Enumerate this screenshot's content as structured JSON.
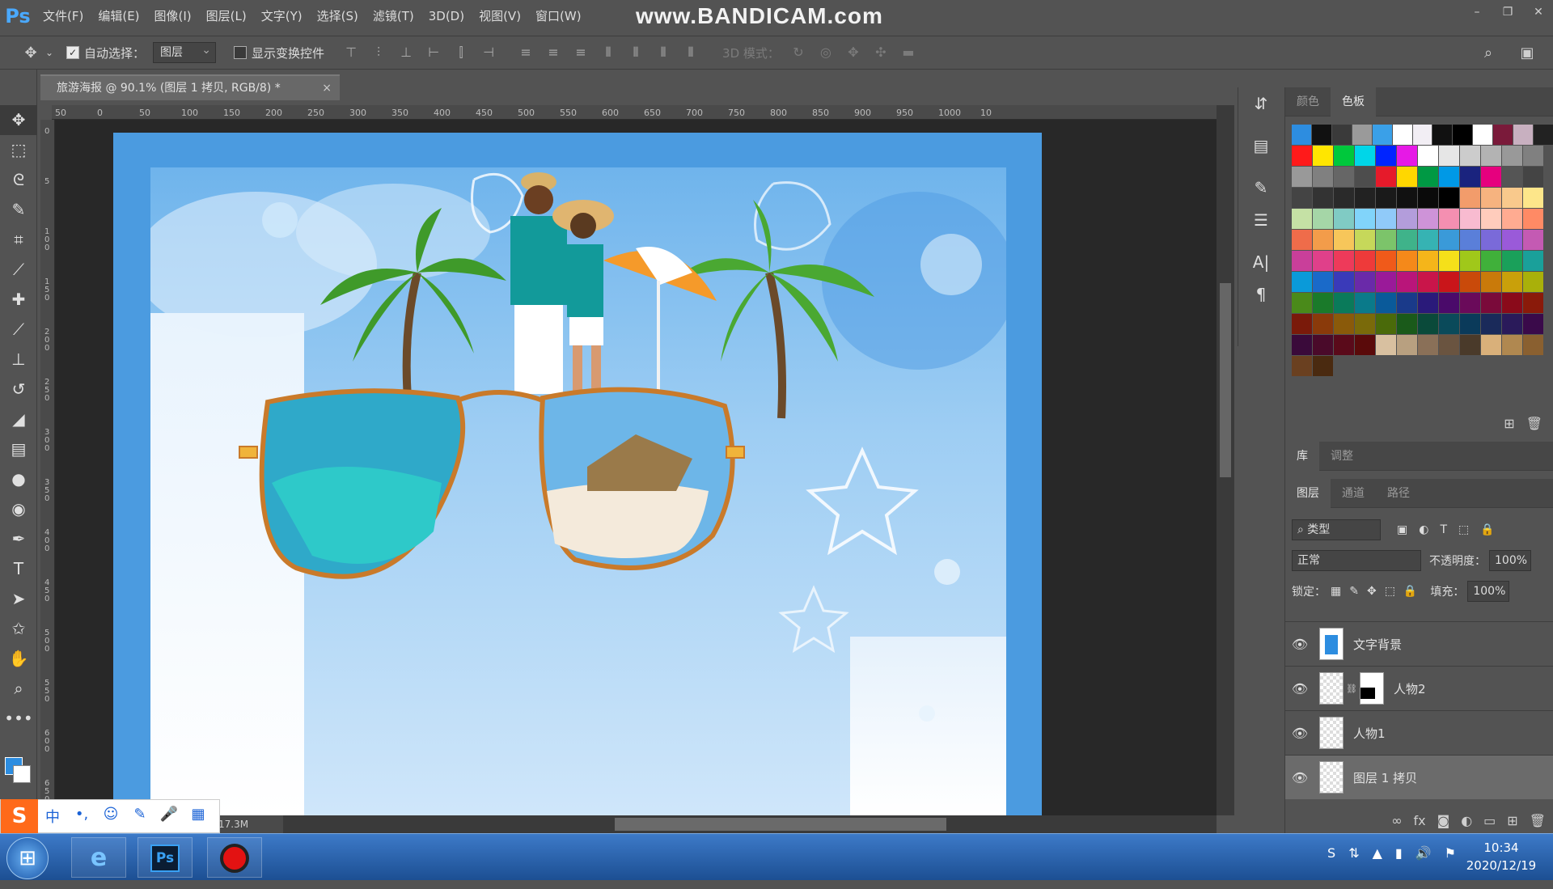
{
  "app": {
    "logo": "Ps",
    "menu": [
      "文件(F)",
      "编辑(E)",
      "图像(I)",
      "图层(L)",
      "文字(Y)",
      "选择(S)",
      "滤镜(T)",
      "3D(D)",
      "视图(V)",
      "窗口(W)"
    ],
    "watermark": "www.BANDICAM.com"
  },
  "options": {
    "auto_select_label": "自动选择：",
    "auto_select_target": "图层",
    "show_transform_label": "显示变换控件",
    "mode_3d_label": "3D 模式："
  },
  "document": {
    "tab_title": "旅游海报 @ 90.1% (图层 1 拷贝, RGB/8) *",
    "close": "×",
    "status_text": "17.3M",
    "ruler_h": [
      "50",
      "0",
      "50",
      "100",
      "150",
      "200",
      "250",
      "300",
      "350",
      "400",
      "450",
      "500",
      "550",
      "600",
      "650",
      "700",
      "750",
      "800",
      "850",
      "900",
      "950",
      "1000",
      "10"
    ],
    "ruler_v": [
      "0",
      "5",
      "1 0 0",
      "1 5 0",
      "2 0 0",
      "2 5 0",
      "3 0 0",
      "3 5 0",
      "4 0 0",
      "4 5 0",
      "5 0 0",
      "5 5 0",
      "6 0 0",
      "6 5 0"
    ]
  },
  "panels": {
    "swatch_tabs": [
      "颜色",
      "色板"
    ],
    "library_tabs": [
      "库",
      "调整"
    ],
    "layer_tabs": [
      "图层",
      "通道",
      "路径"
    ],
    "filter_kind": "类型",
    "blend_mode": "正常",
    "opacity_label": "不透明度：",
    "opacity_value": "100%",
    "lock_label": "锁定：",
    "fill_label": "填充：",
    "fill_value": "100%",
    "layers": [
      {
        "name": "文字背景",
        "thumb": "blue",
        "selected": false
      },
      {
        "name": "人物2",
        "thumb": "mask",
        "selected": false
      },
      {
        "name": "人物1",
        "thumb": "transparent",
        "selected": false
      },
      {
        "name": "图层 1 拷贝",
        "thumb": "transparent",
        "selected": true
      }
    ],
    "swatch_rows": [
      [
        "#2d8de0",
        "#111111",
        "#3a3a3a",
        "#9a9a9a",
        "#3aa0e8",
        "#ffffff",
        "#f2eef4",
        "#111111",
        "#000000",
        "#ffffff",
        "#7a1a3a",
        "#c8b0c0",
        "#222222"
      ],
      [
        "#ff1a1a",
        "#ffe600",
        "#00c83c",
        "#00d6e8",
        "#0024ff",
        "#e619e6",
        "#ffffff",
        "#e6e6e6",
        "#cccccc",
        "#b3b3b3",
        "#999999",
        "#808080"
      ],
      [
        "#999999",
        "#808080",
        "#666666",
        "#4d4d4d",
        "#e61a2a",
        "#ffd700",
        "#009944",
        "#0099e6",
        "#1a237e",
        "#e6007e",
        "#555555",
        "#444444"
      ],
      [
        "#444444",
        "#333333",
        "#2a2a2a",
        "#222222",
        "#1a1a1a",
        "#111111",
        "#0a0a0a",
        "#000000",
        "#f29c6b",
        "#f6b37f",
        "#f9c98c",
        "#fde68a"
      ],
      [
        "#c5e1a5",
        "#a5d6a7",
        "#80cbc4",
        "#81d4fa",
        "#90caf9",
        "#b39ddb",
        "#ce93d8",
        "#f48fb1",
        "#f8bbd0",
        "#ffccbc",
        "#ffab91",
        "#ff8a65"
      ],
      [
        "#ef6c4a",
        "#f39c4a",
        "#f7c65a",
        "#c6d85a",
        "#7cc46a",
        "#3fb38a",
        "#36b3b3",
        "#3a9ad9",
        "#5a7fd9",
        "#7a6ad9",
        "#9a5ad9",
        "#c45ab3"
      ],
      [
        "#c93f9a",
        "#e0408a",
        "#ee3a5a",
        "#ee3a3a",
        "#f05a1a",
        "#f5891a",
        "#f5b51a",
        "#f5e01a",
        "#a0c81a",
        "#40b03a",
        "#1aa05a",
        "#1aa09a"
      ],
      [
        "#0a9ad9",
        "#1a6ac9",
        "#3a3ab9",
        "#6a2aa9",
        "#9a1a99",
        "#b9157a",
        "#c9154a",
        "#c9151a",
        "#c94a0a",
        "#c97a0a",
        "#c9a00a",
        "#a9b00a"
      ],
      [
        "#4a8a1a",
        "#1a7a2a",
        "#0a7a5a",
        "#0a7a8a",
        "#0a5a9a",
        "#1a3a8a",
        "#2a1a7a",
        "#4a0a6a",
        "#6a0a5a",
        "#7a0a3a",
        "#8a0a1a",
        "#8a1a0a"
      ],
      [
        "#7a1a0a",
        "#8a3a0a",
        "#8a5a0a",
        "#7a6a0a",
        "#4a6a0a",
        "#1a5a1a",
        "#0a4a3a",
        "#0a4a5a",
        "#0a3a5a",
        "#1a2a5a",
        "#2a1a5a",
        "#3a0a4a"
      ],
      [
        "#3a0a3a",
        "#4a0a2a",
        "#5a0a1a",
        "#5a0a0a",
        "#d8c0a0",
        "#b8a080",
        "#8a7058",
        "#6a5440",
        "#4a3a2a",
        "#d9b07a",
        "#b08850",
        "#8a6030"
      ],
      [
        "#6a4020",
        "#4a2a10"
      ]
    ]
  },
  "ime": {
    "logo": "S",
    "buttons": [
      "中",
      "•,",
      "☺",
      "✎",
      "🎤",
      "▦"
    ]
  },
  "taskbar": {
    "time": "10:34",
    "date": "2020/12/19"
  }
}
